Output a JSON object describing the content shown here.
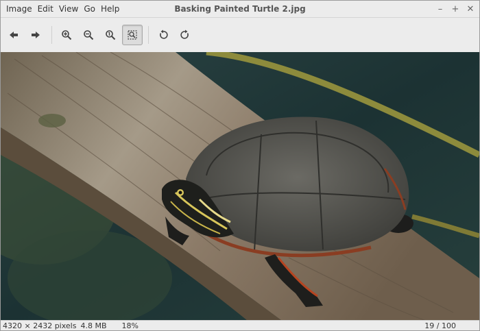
{
  "window": {
    "title": "Basking Painted Turtle 2.jpg"
  },
  "menu": [
    "Image",
    "Edit",
    "View",
    "Go",
    "Help"
  ],
  "window_controls": {
    "minimize": "–",
    "maximize": "+",
    "close": "✕"
  },
  "toolbar": {
    "buttons": [
      {
        "name": "previous-button",
        "icon": "arrow-left-icon"
      },
      {
        "name": "next-button",
        "icon": "arrow-right-icon"
      },
      {
        "name": "zoom-in-button",
        "icon": "zoom-in-icon"
      },
      {
        "name": "zoom-out-button",
        "icon": "zoom-out-icon"
      },
      {
        "name": "zoom-normal-button",
        "icon": "zoom-original-icon"
      },
      {
        "name": "best-fit-button",
        "icon": "fit-icon",
        "active": true
      },
      {
        "name": "rotate-left-button",
        "icon": "rotate-left-icon"
      },
      {
        "name": "rotate-right-button",
        "icon": "rotate-right-icon"
      }
    ]
  },
  "status": {
    "dimensions": "4320 × 2432 pixels",
    "size": "4.8 MB",
    "zoom": "18%",
    "position": "19 / 100"
  },
  "colors": {
    "water": "#1f3434",
    "log": "#8c7a66",
    "shell": "#5d5d58"
  }
}
